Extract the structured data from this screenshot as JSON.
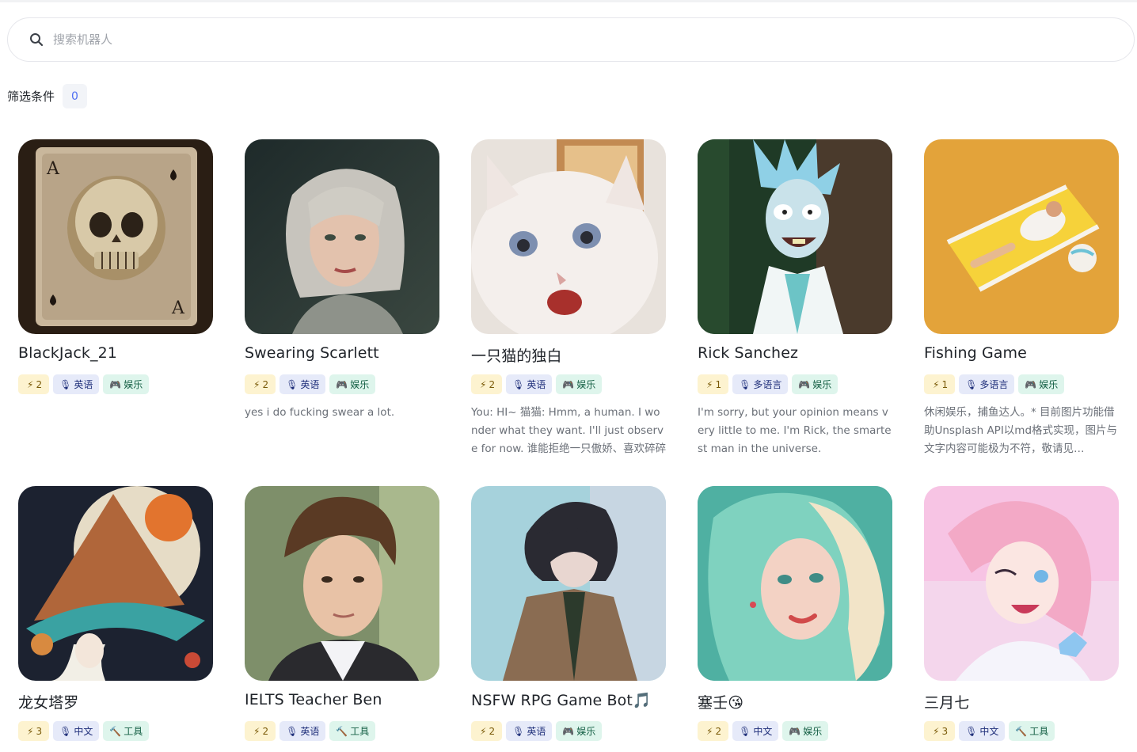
{
  "search": {
    "placeholder": "搜索机器人"
  },
  "filter": {
    "label": "筛选条件",
    "count": "0"
  },
  "bots": [
    {
      "name": "BlackJack_21",
      "level": "2",
      "lang": "英语",
      "lang_icon": "mic-icon",
      "category": "娱乐",
      "category_icon": "gamepad-icon",
      "desc": "",
      "theme": "skull-card"
    },
    {
      "name": "Swearing Scarlett",
      "level": "2",
      "lang": "英语",
      "lang_icon": "mic-icon",
      "category": "娱乐",
      "category_icon": "gamepad-icon",
      "desc": "yes i do fucking swear a lot.",
      "theme": "portrait-woman"
    },
    {
      "name": "一只猫的独白",
      "level": "2",
      "lang": "英语",
      "lang_icon": "mic-icon",
      "category": "娱乐",
      "category_icon": "gamepad-icon",
      "desc": "You: HI~ 猫猫: Hmm, a human. I wonder what they want. I'll just observe for now. 谁能拒绝一只傲娇、喜欢碎碎念…",
      "theme": "white-cat"
    },
    {
      "name": "Rick Sanchez",
      "level": "1",
      "lang": "多语言",
      "lang_icon": "mic-icon",
      "category": "娱乐",
      "category_icon": "gamepad-icon",
      "desc": "I'm sorry, but your opinion means very little to me. I'm Rick, the smartest man in the universe.",
      "theme": "cartoon-scientist"
    },
    {
      "name": "Fishing Game",
      "level": "1",
      "lang": "多语言",
      "lang_icon": "mic-icon",
      "category": "娱乐",
      "category_icon": "gamepad-icon",
      "desc": "休闲娱乐，捕鱼达人。* 目前图片功能借助Unsplash API以md格式实现，图片与文字内容可能极为不符，敬请见…",
      "theme": "beach-chair"
    },
    {
      "name": "龙女塔罗",
      "level": "3",
      "lang": "中文",
      "lang_icon": "mic-icon",
      "category": "工具",
      "category_icon": "hammer-icon",
      "desc": "",
      "theme": "tarot-witch"
    },
    {
      "name": "IELTS Teacher Ben",
      "level": "2",
      "lang": "英语",
      "lang_icon": "mic-icon",
      "category": "工具",
      "category_icon": "hammer-icon",
      "desc": "",
      "theme": "portrait-man"
    },
    {
      "name": "NSFW RPG Game Bot🎵",
      "level": "2",
      "lang": "英语",
      "lang_icon": "mic-icon",
      "category": "娱乐",
      "category_icon": "gamepad-icon",
      "desc": "",
      "theme": "anime-man"
    },
    {
      "name": "塞壬😘",
      "level": "2",
      "lang": "中文",
      "lang_icon": "mic-icon",
      "category": "娱乐",
      "category_icon": "gamepad-icon",
      "desc": "",
      "theme": "teal-hair-woman"
    },
    {
      "name": "三月七",
      "level": "3",
      "lang": "中文",
      "lang_icon": "mic-icon",
      "category": "工具",
      "category_icon": "hammer-icon",
      "desc": "",
      "theme": "anime-pink-girl"
    }
  ]
}
